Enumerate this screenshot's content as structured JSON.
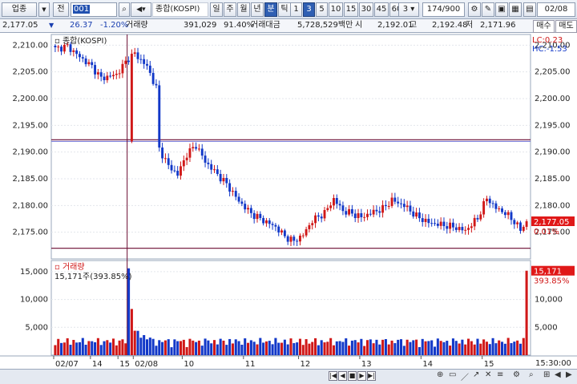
{
  "toolbar": {
    "market_select": "업종",
    "type_select": "전",
    "code_value": "001",
    "name_value": "종합(KOSPI)",
    "periods": [
      "일",
      "주",
      "월",
      "년",
      "분",
      "틱"
    ],
    "selected_period": "분",
    "intervals": [
      "1",
      "3",
      "5",
      "10",
      "15",
      "30",
      "45",
      "60"
    ],
    "selected_interval": "3",
    "count_select": "3",
    "count_value": "174/900",
    "date_value": "02/08"
  },
  "info": {
    "price": "2,177.05",
    "change": "26.37",
    "change_pct": "-1.20%",
    "vol_label": "거래량",
    "volume": "391,029",
    "vol_ratio": "91.40%",
    "amt_label": "거래대금",
    "amount": "5,728,529백만",
    "open_label": "시",
    "open": "2,192.01",
    "high_label": "고",
    "high": "2,192.48",
    "low_label": "저",
    "low": "2,171.96"
  },
  "side_buttons": {
    "buy": "매수",
    "sell": "매도"
  },
  "price_panel": {
    "title": "종합(KOSPI)",
    "lc_label": "LC:0.23",
    "hc_label": "HC:-1.53",
    "last_price_tag": "2,177.05",
    "last_pct_tag": "0.01%",
    "y_ticks": [
      "2,210.00",
      "2,205.00",
      "2,200.00",
      "2,195.00",
      "2,190.00",
      "2,185.00",
      "2,180.00",
      "2,175.00"
    ]
  },
  "volume_panel": {
    "title": "거래량",
    "readout": "15,171주(393.85%)",
    "last_volume_tag": "15,171",
    "last_vol_pct_tag": "393.85%",
    "y_ticks": [
      "15,000",
      "10,000",
      "5,000"
    ]
  },
  "x_axis": {
    "labels": [
      "02/07",
      "14",
      "15",
      "02/08",
      "10",
      "11",
      "12",
      "13",
      "14",
      "15"
    ],
    "time_label": "15:30:00"
  },
  "colors": {
    "up": "#d01818",
    "down": "#1238c8",
    "frame": "#9aa7bb",
    "hline": "#6a0a30"
  },
  "chart_data": {
    "type": "candlestick",
    "symbol": "종합(KOSPI)",
    "interval": "3분",
    "ylim": [
      2170,
      2212
    ],
    "volume_ylim": [
      0,
      17000
    ],
    "reference_lines": [
      2192.3,
      2172.0
    ],
    "last": {
      "price": 2177.05,
      "volume": 15171
    },
    "day_break_index": 24,
    "close_path": [
      [
        0,
        2209.3
      ],
      [
        4,
        2209.8
      ],
      [
        8,
        2207.8
      ],
      [
        12,
        2206.0
      ],
      [
        15,
        2203.8
      ],
      [
        20,
        2204.5
      ],
      [
        24,
        2207.6
      ],
      [
        26,
        2208.4
      ],
      [
        30,
        2206.0
      ],
      [
        33,
        2202.0
      ],
      [
        34,
        2190.6
      ],
      [
        37,
        2187.4
      ],
      [
        40,
        2185.8
      ],
      [
        43,
        2189.6
      ],
      [
        46,
        2191.3
      ],
      [
        49,
        2188.2
      ],
      [
        52,
        2186.4
      ],
      [
        56,
        2184.0
      ],
      [
        60,
        2180.8
      ],
      [
        64,
        2178.5
      ],
      [
        68,
        2177.2
      ],
      [
        72,
        2176.0
      ],
      [
        75,
        2174.2
      ],
      [
        78,
        2173.3
      ],
      [
        81,
        2174.5
      ],
      [
        84,
        2177.2
      ],
      [
        88,
        2178.6
      ],
      [
        91,
        2181.2
      ],
      [
        94,
        2179.0
      ],
      [
        97,
        2178.5
      ],
      [
        100,
        2177.8
      ],
      [
        104,
        2178.8
      ],
      [
        107,
        2179.4
      ],
      [
        110,
        2181.0
      ],
      [
        114,
        2180.0
      ],
      [
        118,
        2178.0
      ],
      [
        122,
        2176.8
      ],
      [
        126,
        2176.4
      ],
      [
        130,
        2176.0
      ],
      [
        134,
        2175.3
      ],
      [
        138,
        2177.6
      ],
      [
        141,
        2181.4
      ],
      [
        144,
        2179.5
      ],
      [
        147,
        2178.6
      ],
      [
        150,
        2177.0
      ],
      [
        152,
        2175.4
      ],
      [
        154,
        2177.05
      ]
    ],
    "volume_spike": [
      {
        "index": 24,
        "value": 15600
      },
      {
        "index": 25,
        "value": 8300
      },
      {
        "index": 154,
        "value": 15171
      }
    ]
  }
}
